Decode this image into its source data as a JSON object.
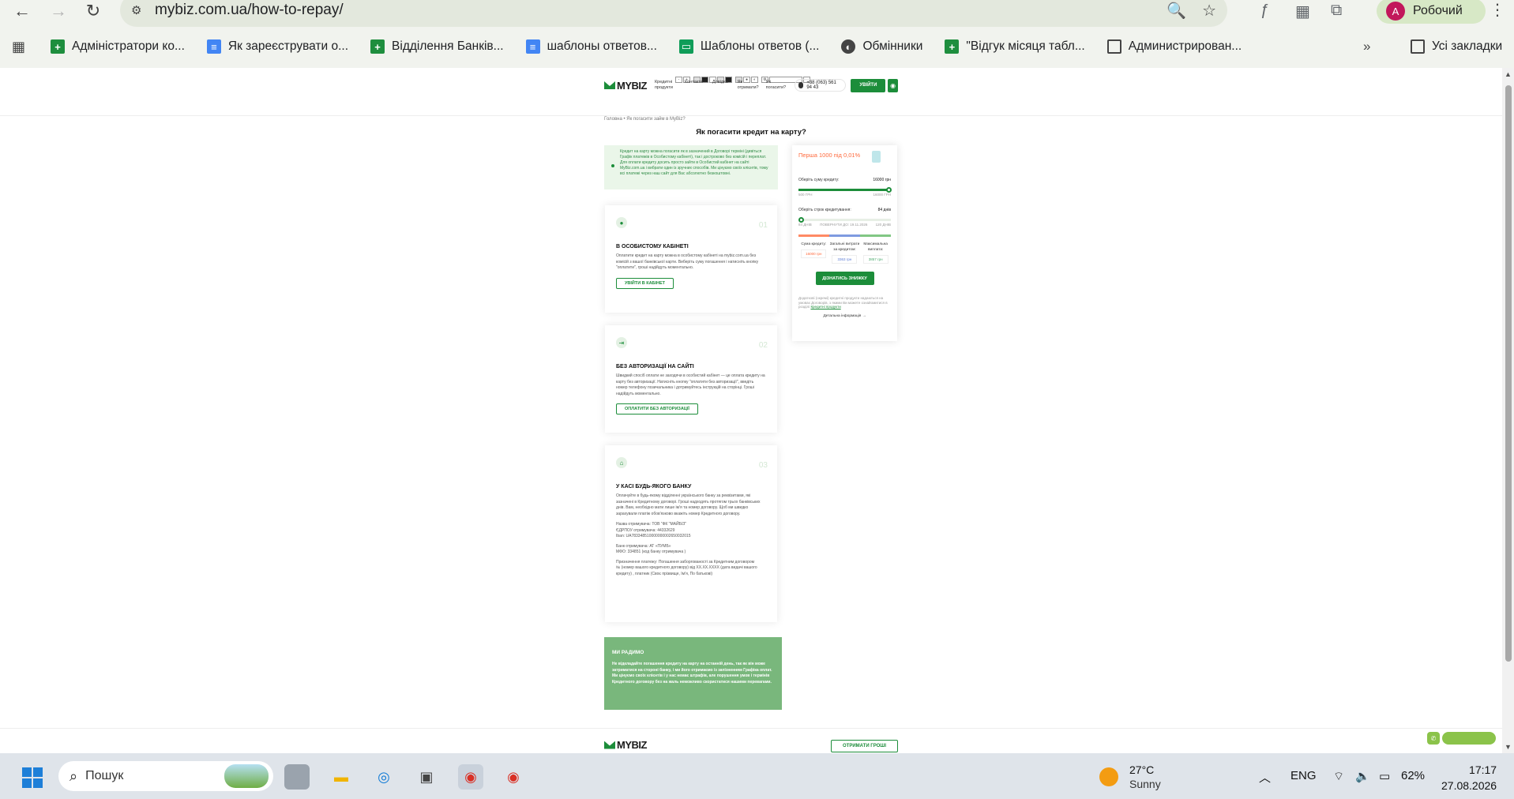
{
  "browser": {
    "url_domain": "mybiz.com.ua",
    "url_path": "/how-to-repay/",
    "profile_initial": "A",
    "profile_name": "Робочий",
    "bookmarks": [
      {
        "label": "Адміністратори ко...",
        "icon": "sheets-icon"
      },
      {
        "label": "Як зареєструвати о...",
        "icon": "docs-icon"
      },
      {
        "label": "Відділення Банків...",
        "icon": "sheets-icon"
      },
      {
        "label": "шаблоны ответов...",
        "icon": "docs-icon"
      },
      {
        "label": "Шаблоны ответов (...",
        "icon": "slides-icon"
      },
      {
        "label": "Обмінники",
        "icon": "globe-icon"
      },
      {
        "label": "\"Відгук місяця табл...",
        "icon": "sheets-icon"
      },
      {
        "label": "Администрирован...",
        "icon": "folder-icon"
      }
    ],
    "all_bookmarks": "Усі закладки"
  },
  "site": {
    "logo": "MYBIZ",
    "menu": [
      "Кредитні продукти",
      "Контакти",
      "Довідка",
      "Як отримати?",
      "Як погасити?"
    ],
    "phone": "+38 (063) 561 94 43",
    "login": "УВІЙТИ",
    "breadcrumb": "Головна • Як погасити займ в MyBiz?",
    "title": "Як погасити кредит на карту?",
    "intro": "Кредит на карту можна погасити як в зазначений в Договорі терміні (дивіться Графік платежів в Особистому кабінеті), так і достроково без комісій і переплат. Для оплати кредиту досить просто зайти в Особистий кабінет на сайті MyBiz.com.ua і вибрати один із зручних способів. Ми цінуємо своїх клієнтів, тому всі платежі через наш сайт для Вас абсолютно безкоштовні.",
    "steps": [
      {
        "num": "01",
        "title": "В ОСОБИСТОМУ КАБІНЕТІ",
        "text": "Оплатити кредит на карту можна в особистому кабінеті на mybiz.com.ua без комісій з вашої банківської карти. Виберіть суму погашення і натисніть кнопку \"оплатити\", гроші надійдуть моментально.",
        "button": "УВІЙТИ В КАБІНЕТ"
      },
      {
        "num": "02",
        "title": "БЕЗ АВТОРИЗАЦІЇ НА САЙТІ",
        "text": "Швидкий спосіб оплати не заходячи в особистий кабінет — це оплата кредиту на карту без авторизації. Натисніть кнопку \"оплатити без авторизації\", введіть номер телефону позичальника і дотримуйтесь інструкцій на сторінці. Гроші надійдуть моментально.",
        "button": "ОПЛАТИТИ БЕЗ АВТОРИЗАЦІЇ"
      },
      {
        "num": "03",
        "title": "У КАСІ БУДЬ-ЯКОГО БАНКУ",
        "text": "Оплачуйте в будь-якому відділенні українського банку за реквізитами, які зазначені в Кредитному договорі. Гроші надходять протягом трьох банківських днів. Вам, необхідно мати лише ім'я та номер договору. Щоб ми швидко зарахували платіж обов'язково вкажіть номер Кредитного договору.",
        "details": [
          "Назва отримувача: ТОВ \"ФК \"МАЙБІЗ\"",
          "ЄДРПОУ отримувача: 44332629",
          "Iban: UA783348510000000002650032015",
          "Банк отримувача: АТ «ПУМБ»",
          "МФО: 334851 (код банку отримувача )",
          "Призначення платежу: Погашення заборгованості за Кредитним договором",
          "№ (номер вашого кредитного договору) від XX.XX.XXXX (дата видачі вашого кредиту) , платник (Своє прізвище, Ім'я, По батькові)"
        ]
      }
    ],
    "note": {
      "title": "МИ РАДИМО",
      "text": "Не відкладайте погашення кредиту на карту на останній день, так як він може затриматися на стороні банку, і ми його отримаємо із запізненням Графіка оплат. Ми цінуємо своїх клієнтів і у нас немає штрафів, але порушення умов і термінів Кредитного договору без на жаль неможливо скористатися нашими перевагами."
    },
    "calculator": {
      "promo": "Перша 1000 під 0,01%",
      "amount_label": "Оберіть суму кредиту:",
      "amount_value": "16000 грн",
      "amount_min": "500 ГРН",
      "amount_max": "16000 ГРН",
      "amount_fraction": 1.0,
      "term_label": "Оберіть строк кредитування:",
      "term_value": "84 днів",
      "term_min": "84 ДНІВ",
      "term_due": "ПОВЕРНУТИ ДО: 19.11.2026",
      "term_max": "120 ДНІВ",
      "term_fraction": 0.0,
      "summary": [
        {
          "label": "Сума кредиту:",
          "value": "16000 грн",
          "tone": "o"
        },
        {
          "label": "Загальні витрати за кредитом:",
          "value": "3363 грн",
          "tone": "b"
        },
        {
          "label": "Максимальна виплата:",
          "value": "3857 грн",
          "tone": "g"
        }
      ],
      "cta": "ДІЗНАТИСЬ ЗНИЖКУ",
      "fine_print": "Додаткові (окремі) кредитні продукти надаються на умовах Договорів, з якими Ви можете ознайомитися в розділі",
      "fine_link": "Кредитні продукти",
      "more": "Детальна інформація →"
    },
    "footer_button": "ОТРИМАТИ ГРОШІ",
    "colors": {
      "brand": "#1c8d3a",
      "accent": "#ff6a3d",
      "note_bg": "#79b77c"
    }
  },
  "taskbar": {
    "search_placeholder": "Пошук",
    "temperature": "27°C",
    "weather": "Sunny",
    "language": "ENG",
    "battery": "62%",
    "time": "17:17",
    "date": "27.08.2026"
  }
}
